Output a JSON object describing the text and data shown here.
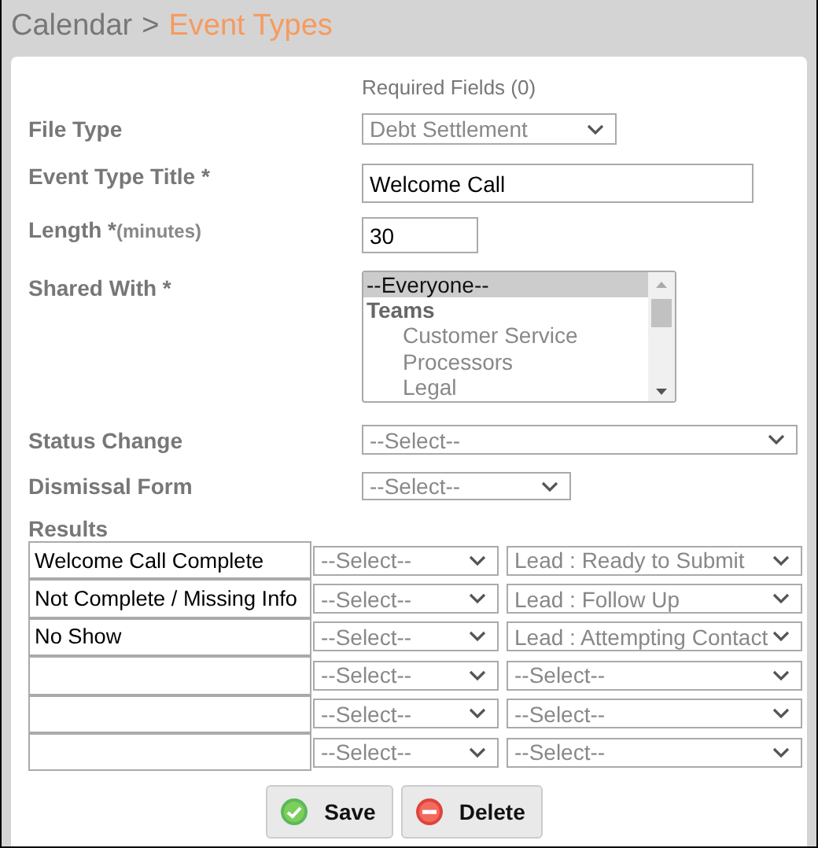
{
  "header": {
    "breadcrumb": [
      {
        "label": "Calendar",
        "selected": false
      },
      {
        "label": "Event Types",
        "selected": true
      }
    ],
    "separator": ">"
  },
  "required_fields": "Required Fields (0)",
  "file_type": {
    "label": "File Type",
    "value": "Debt Settlement"
  },
  "event_type_title": {
    "label": "Event Type Title *",
    "value": "Welcome Call"
  },
  "length": {
    "label": "Length *",
    "note": "(minutes)",
    "value": "30"
  },
  "shared_with": {
    "label": "Shared With *",
    "options": [
      {
        "kind": "option",
        "label": "--Everyone--",
        "selected": true
      },
      {
        "kind": "group",
        "label": "Teams"
      },
      {
        "kind": "suboption",
        "label": "Customer Service",
        "selected": false
      },
      {
        "kind": "suboption",
        "label": "Processors",
        "selected": false
      },
      {
        "kind": "suboption",
        "label": "Legal",
        "selected": false
      }
    ]
  },
  "status_change": {
    "label": "Status Change",
    "value": "--Select--"
  },
  "dismissal_form": {
    "label": "Dismissal Form",
    "value": "--Select--"
  },
  "results": {
    "label": "Results",
    "rows": [
      {
        "name": "Welcome Call Complete",
        "action": "--Select--",
        "status": "Lead : Ready to Submit"
      },
      {
        "name": "Not Complete / Missing Info",
        "action": "--Select--",
        "status": "Lead : Follow Up"
      },
      {
        "name": "No Show",
        "action": "--Select--",
        "status": "Lead : Attempting Contact"
      },
      {
        "action": "--Select--",
        "status": "--Select--"
      },
      {
        "action": "--Select--",
        "status": "--Select--"
      },
      {
        "action": "--Select--",
        "status": "--Select--"
      }
    ]
  },
  "buttons": [
    {
      "kind": "save",
      "label": "Save"
    },
    {
      "kind": "delete",
      "label": "Delete"
    }
  ]
}
